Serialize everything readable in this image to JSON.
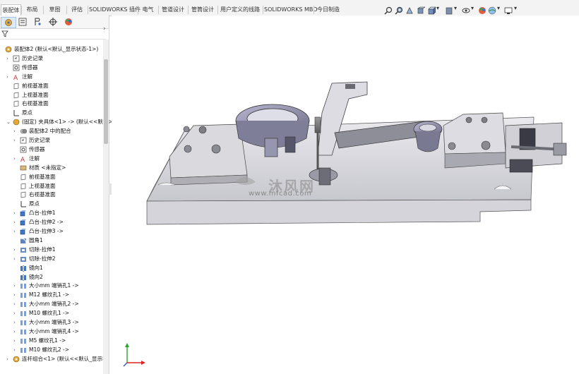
{
  "command_tabs": [
    {
      "label": "装配体",
      "active": true
    },
    {
      "label": "布局",
      "active": false
    },
    {
      "label": "草图",
      "active": false
    },
    {
      "label": "评估",
      "active": false
    },
    {
      "label": "SOLIDWORKS 插件",
      "active": false
    },
    {
      "label": "电气",
      "active": false
    },
    {
      "label": "管道设计",
      "active": false
    },
    {
      "label": "管筒设计",
      "active": false
    },
    {
      "label": "用户定义的线路",
      "active": false
    },
    {
      "label": "SOLIDWORKS MBD",
      "active": false
    },
    {
      "label": "今日制造",
      "active": false
    }
  ],
  "view_toolbar_icons": [
    "zoom-to-fit-icon",
    "zoom-area-icon",
    "previous-view-icon",
    "section-view-icon",
    "view-orientation-icon",
    "display-style-icon",
    "hide-show-icon",
    "appearance-icon",
    "scene-icon",
    "view-settings-icon"
  ],
  "feature_tree_tabs": [
    "feature-manager-icon",
    "property-manager-icon",
    "configuration-manager-icon",
    "dimxpert-icon",
    "display-manager-icon"
  ],
  "feature_tree": [
    {
      "label": "装配体2 (默认<默认_显示状态-1>)",
      "icon": "assembly-icon",
      "indent": 0,
      "expand": "none"
    },
    {
      "label": "历史记录",
      "icon": "history-icon",
      "indent": 1,
      "expand": "right"
    },
    {
      "label": "传感器",
      "icon": "sensor-icon",
      "indent": 1,
      "expand": "none"
    },
    {
      "label": "注解",
      "icon": "annotation-icon",
      "indent": 1,
      "expand": "right"
    },
    {
      "label": "前视基准面",
      "icon": "plane-icon",
      "indent": 1,
      "expand": "none"
    },
    {
      "label": "上视基准面",
      "icon": "plane-icon",
      "indent": 1,
      "expand": "none"
    },
    {
      "label": "右视基准面",
      "icon": "plane-icon",
      "indent": 1,
      "expand": "none"
    },
    {
      "label": "原点",
      "icon": "origin-icon",
      "indent": 1,
      "expand": "none"
    },
    {
      "label": "(固定) 夹具体<1> -> (默认<<默认>_显",
      "icon": "part-icon",
      "indent": 1,
      "expand": "down"
    },
    {
      "label": "装配体2 中的配合",
      "icon": "mates-icon",
      "indent": 2,
      "expand": "right"
    },
    {
      "label": "历史记录",
      "icon": "history-icon",
      "indent": 2,
      "expand": "right"
    },
    {
      "label": "传感器",
      "icon": "sensor-icon",
      "indent": 2,
      "expand": "none"
    },
    {
      "label": "注解",
      "icon": "annotation-icon",
      "indent": 2,
      "expand": "right"
    },
    {
      "label": "材质 <未指定>",
      "icon": "material-icon",
      "indent": 2,
      "expand": "none"
    },
    {
      "label": "前视基准面",
      "icon": "plane-icon",
      "indent": 2,
      "expand": "none"
    },
    {
      "label": "上视基准面",
      "icon": "plane-icon",
      "indent": 2,
      "expand": "none"
    },
    {
      "label": "右视基准面",
      "icon": "plane-icon",
      "indent": 2,
      "expand": "none"
    },
    {
      "label": "原点",
      "icon": "origin-icon",
      "indent": 2,
      "expand": "none"
    },
    {
      "label": "凸台-拉伸1",
      "icon": "extrude-icon",
      "indent": 2,
      "expand": "right"
    },
    {
      "label": "凸台-拉伸2 ->",
      "icon": "extrude-icon",
      "indent": 2,
      "expand": "right"
    },
    {
      "label": "凸台-拉伸3 ->",
      "icon": "extrude-icon",
      "indent": 2,
      "expand": "right"
    },
    {
      "label": "圆角1",
      "icon": "fillet-icon",
      "indent": 2,
      "expand": "none"
    },
    {
      "label": "切除-拉伸1",
      "icon": "cut-icon",
      "indent": 2,
      "expand": "right"
    },
    {
      "label": "切除-拉伸2",
      "icon": "cut-icon",
      "indent": 2,
      "expand": "right"
    },
    {
      "label": "镜向1",
      "icon": "mirror-icon",
      "indent": 2,
      "expand": "none"
    },
    {
      "label": "镜向2",
      "icon": "mirror-icon",
      "indent": 2,
      "expand": "none"
    },
    {
      "label": "大小mm 端销孔1 ->",
      "icon": "hole-icon",
      "indent": 2,
      "expand": "right"
    },
    {
      "label": "M12 螺纹孔1 ->",
      "icon": "hole-icon",
      "indent": 2,
      "expand": "right"
    },
    {
      "label": "大小mm 端销孔2 ->",
      "icon": "hole-icon",
      "indent": 2,
      "expand": "right"
    },
    {
      "label": "M10 螺纹孔1 ->",
      "icon": "hole-icon",
      "indent": 2,
      "expand": "right"
    },
    {
      "label": "大小mm 端销孔3 ->",
      "icon": "hole-icon",
      "indent": 2,
      "expand": "right"
    },
    {
      "label": "大小mm 端销孔4 ->",
      "icon": "hole-icon",
      "indent": 2,
      "expand": "right"
    },
    {
      "label": "M5 螺纹孔1 ->",
      "icon": "hole-icon",
      "indent": 2,
      "expand": "right"
    },
    {
      "label": "M10 螺纹孔2 ->",
      "icon": "hole-icon",
      "indent": 2,
      "expand": "right"
    },
    {
      "label": "连杆组合<1> (默认<<默认_显示状",
      "icon": "subassembly-icon",
      "indent": 1,
      "expand": "right"
    }
  ],
  "watermark": {
    "text": "沐风网",
    "url": "www.mfcad.com"
  },
  "colors": {
    "tab_bg": "#f3f3f3",
    "part_grey": "#d9d9de",
    "accent_blue": "#3a6fb0"
  }
}
